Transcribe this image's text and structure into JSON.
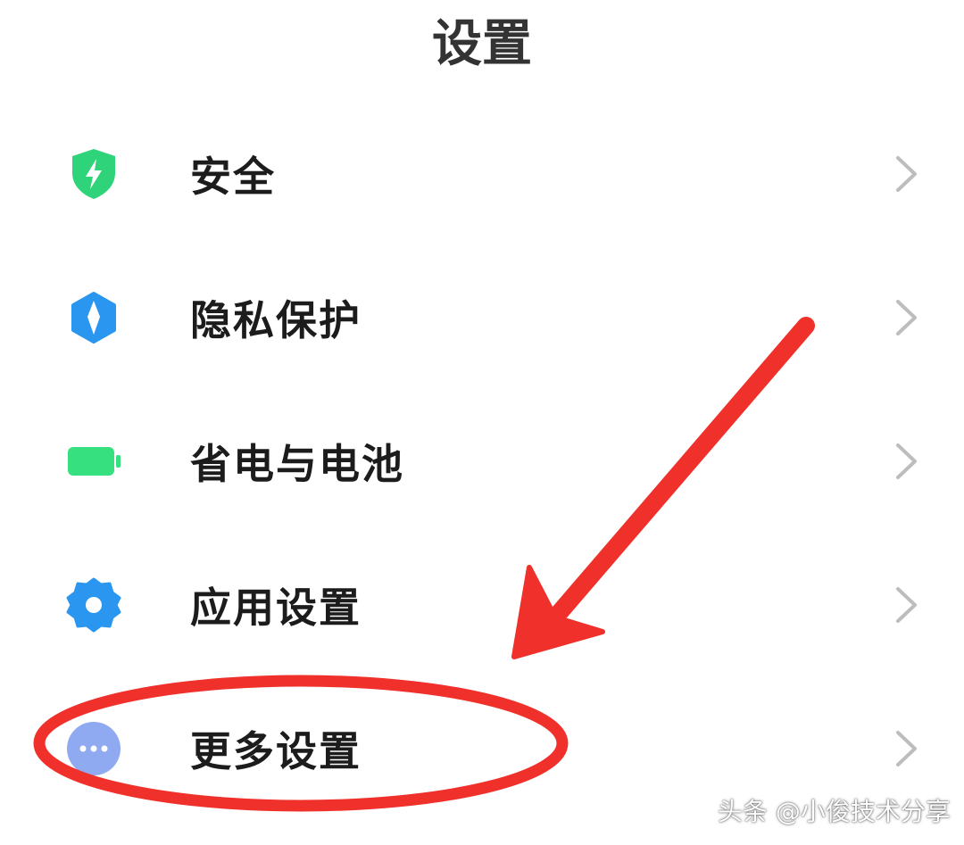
{
  "header": {
    "title": "设置"
  },
  "items": [
    {
      "label": "安全",
      "icon": "shield-bolt-icon",
      "color": "#2fd47a"
    },
    {
      "label": "隐私保护",
      "icon": "privacy-icon",
      "color": "#2a96f0"
    },
    {
      "label": "省电与电池",
      "icon": "battery-icon",
      "color": "#37e07f"
    },
    {
      "label": "应用设置",
      "icon": "gear-icon",
      "color": "#2a96f0"
    },
    {
      "label": "更多设置",
      "icon": "more-dots-icon",
      "color": "#8faaf0"
    }
  ],
  "chevron": {
    "icon": "chevron-right-icon",
    "color": "#bdbdbd"
  },
  "annotation": {
    "color": "#f0302a",
    "shapes": [
      "arrow",
      "ellipse"
    ]
  },
  "watermark": {
    "text": "头条 @小俊技术分享"
  }
}
